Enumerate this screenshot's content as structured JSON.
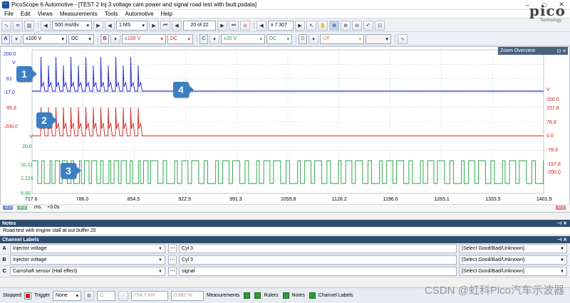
{
  "window": {
    "title": "PicoScope 6 Automotive - [TEST 2 Inj 3 voltage cam power and signal road test with fault.psdata]",
    "minimize": "–",
    "maximize": "□",
    "close": "✕"
  },
  "menu": [
    "File",
    "Edit",
    "Views",
    "Measurements",
    "Tools",
    "Automotive",
    "Help"
  ],
  "toolbar1": {
    "timebase": "500 ms/div",
    "samples": "1 MS",
    "buffer": "20 of 22",
    "zoom": "x 7.307"
  },
  "logo": {
    "text": "pico",
    "sub": "Technology"
  },
  "channels": [
    {
      "letter": "A",
      "range": "±100 V",
      "coupling": "DC",
      "color": "#2020d0"
    },
    {
      "letter": "B",
      "range": "±100 V",
      "coupling": "DC",
      "color": "#d02020"
    },
    {
      "letter": "C",
      "range": "±20 V",
      "coupling": "DC",
      "color": "#20a040"
    },
    {
      "letter": "D",
      "range": "Off",
      "coupling": "",
      "color": "#d0a030"
    }
  ],
  "scope": {
    "zoom_overview": "Zoom Overview",
    "left_labels": {
      "a_top": "200.0",
      "a_v": "V",
      "a_mid": "61",
      "a_bot": "-17.0",
      "b_top": "-95.9",
      "b_bot": "-200.0",
      "b_v": "V",
      "c_top": "20.0",
      "c_mid1": "10.11",
      "c_mid2": "2.224",
      "c_bot": "-5.66"
    },
    "right_labels": {
      "v1": "V",
      "r1": "200.0",
      "r2": "157.8",
      "r3": "78.9",
      "r4": "0.0",
      "r5": "-78.9",
      "r6": "-157.8",
      "r7": "-200.0"
    },
    "x_ticks": [
      "717.6",
      "786.0",
      "854.5",
      "922.9",
      "991.3",
      "1059.8",
      "1128.2",
      "1196.6",
      "1265.1",
      "1333.5",
      "1401.9"
    ],
    "x_unit": "ms",
    "x_offset": "+3.0s",
    "ruler_left1": "-0.5",
    "ruler_left2": "-0.5",
    "ruler_right": "-0.5"
  },
  "callouts": [
    "1",
    "2",
    "3",
    "4"
  ],
  "notes": {
    "header": "Notes",
    "text": "Road test with engine stall at out buffer 20"
  },
  "channel_labels": {
    "header": "Channel Labels",
    "rows": [
      {
        "letter": "A",
        "sensor": "Injector voltage",
        "label": "Cyl 3",
        "rating": "[Select Good/Bad/Unknown]"
      },
      {
        "letter": "B",
        "sensor": "Injector voltage",
        "label": "Cyl 3",
        "rating": "[Select Good/Bad/Unknown]"
      },
      {
        "letter": "C",
        "sensor": "Camshaft sensor (Hall effect)",
        "label": "signal",
        "rating": "[Select Good/Bad/Unknown]"
      }
    ]
  },
  "status": {
    "state": "Stopped",
    "trigger_label": "Trigger",
    "trigger_mode": "None",
    "trigger_ch": "C",
    "level": "754.7 mV",
    "pretrigger": "0.882 %",
    "measurements": "Measurements",
    "rulers": "Rulers",
    "notes": "Notes",
    "channel_labels": "Channel Labels"
  },
  "watermark": "CSDN @虹科Pico汽车示波器"
}
